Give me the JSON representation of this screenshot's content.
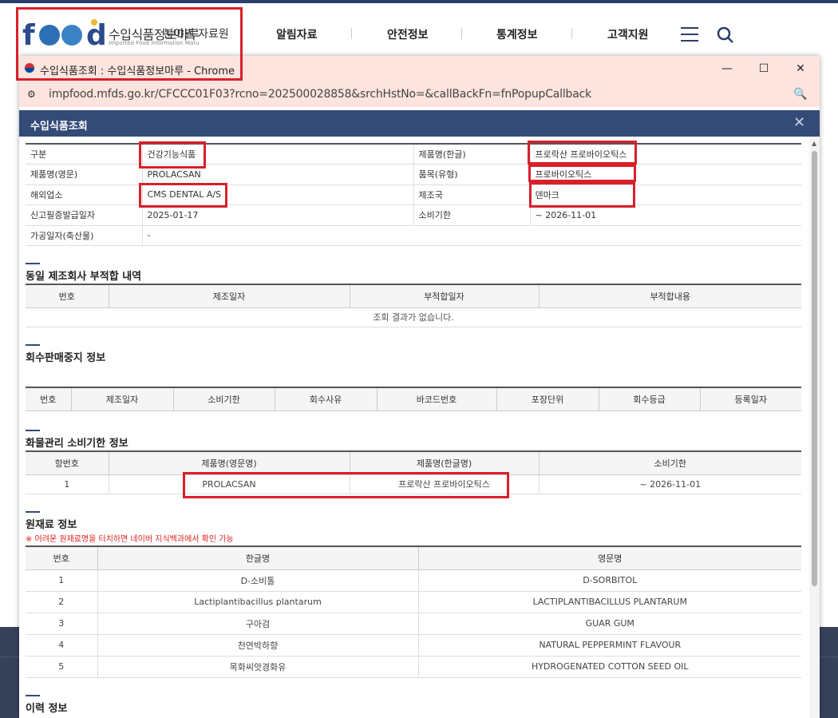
{
  "site": {
    "logo_text": "수입식품정보마루",
    "logo_sub": "Imported Food Information Maru",
    "nav_extra": "분야별 자료원",
    "nav": [
      "알림자료",
      "안전정보",
      "통계정보",
      "고객지원"
    ]
  },
  "window": {
    "title": "수입식품조회 : 수입식품정보마루 - Chrome",
    "url": "impfood.mfds.go.kr/CFCCC01F03?rcno=202500028858&srchHstNo=&callBackFn=fnPopupCallback"
  },
  "popup": {
    "title": "수입식품조회"
  },
  "info": {
    "category_label": "구분",
    "category_value": "건강기능식품",
    "name_ko_label": "제품명(한글)",
    "name_ko_value": "프로락산 프로바이오틱스",
    "name_en_label": "제품명(영문)",
    "name_en_value": "PROLACSAN",
    "item_type_label": "품목(유형)",
    "item_type_value": "프로바이오틱스",
    "overseas_label": "해외업소",
    "overseas_value": "CMS DENTAL A/S",
    "country_label": "제조국",
    "country_value": "덴마크",
    "issue_date_label": "신고필증발급일자",
    "issue_date_value": "2025-01-17",
    "expiry_label": "소비기한",
    "expiry_value": "~ 2026-11-01",
    "processing_label": "가공일자(축산물)",
    "processing_value": "-"
  },
  "sec_nonconform": {
    "title": "동일 제조회사 부적합 내역",
    "headers": [
      "번호",
      "제조일자",
      "부적합일자",
      "부적합내용"
    ],
    "empty_text": "조회 결과가 없습니다."
  },
  "sec_recall": {
    "title": "회수판매중지 정보",
    "headers": [
      "번호",
      "제조일자",
      "소비기한",
      "회수사유",
      "바코드번호",
      "포장단위",
      "회수등급",
      "등록일자"
    ]
  },
  "sec_cargo": {
    "title": "화물관리 소비기한 정보",
    "headers": [
      "항번호",
      "제품명(영문명)",
      "제품명(한글명)",
      "소비기한"
    ],
    "rows": [
      [
        "1",
        "PROLACSAN",
        "프로락산 프로바이오틱스",
        "~ 2026-11-01"
      ]
    ]
  },
  "sec_ingredients": {
    "title": "원재료 정보",
    "note": "※ 어려운 원재료명을 터치하면 네이버 지식백과에서 확인 가능",
    "headers": [
      "번호",
      "한글명",
      "영문명"
    ],
    "rows": [
      [
        "1",
        "D-소비톨",
        "D-SORBITOL"
      ],
      [
        "2",
        "Lactiplantibacillus plantarum",
        "LACTIPLANTIBACILLUS PLANTARUM"
      ],
      [
        "3",
        "구아검",
        "GUAR GUM"
      ],
      [
        "4",
        "천연박하향",
        "NATURAL PEPPERMINT FLAVOUR"
      ],
      [
        "5",
        "목화씨앗경화유",
        "HYDROGENATED COTTON SEED OIL"
      ]
    ]
  },
  "sec_history": {
    "title": "이력 정보"
  },
  "colors": {
    "highlight": "#d9202a",
    "header_bar": "#344a77",
    "chrome_tint": "#fde4df"
  }
}
